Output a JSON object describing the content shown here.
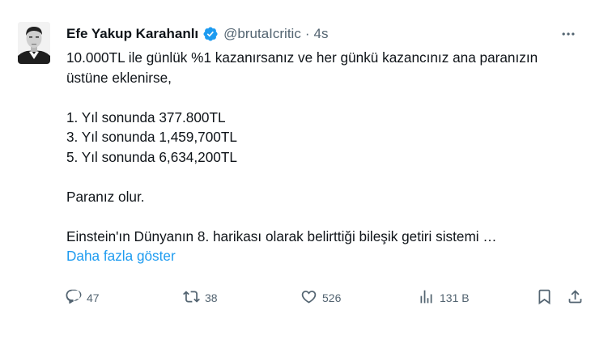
{
  "author": {
    "name": "Efe Yakup Karahanlı",
    "handle": "@brutaIcritic",
    "separator": "·",
    "time": "4s"
  },
  "tweet": {
    "line1": "10.000TL ile günlük %1 kazanırsanız ve her günkü kazancınız ana paranızın üstüne eklenirse,",
    "line2": "1. Yıl sonunda 377.800TL",
    "line3": "3. Yıl sonunda 1,459,700TL",
    "line4": "5. Yıl sonunda 6,634,200TL",
    "line5": "Paranız olur.",
    "line6": "Einstein'ın Dünyanın 8. harikası olarak belirttiği bileşik getiri sistemi …",
    "show_more": "Daha fazla göster"
  },
  "actions": {
    "replies": "47",
    "reposts": "38",
    "likes": "526",
    "views": "131 B"
  },
  "icons": {
    "verified": "verified-badge-icon",
    "more": "more-options-icon",
    "reply": "reply-icon",
    "repost": "repost-icon",
    "like": "heart-icon",
    "views": "analytics-icon",
    "bookmark": "bookmark-icon",
    "share": "share-icon"
  },
  "colors": {
    "accent": "#1d9bf0",
    "text": "#0f1419",
    "muted": "#536471"
  }
}
